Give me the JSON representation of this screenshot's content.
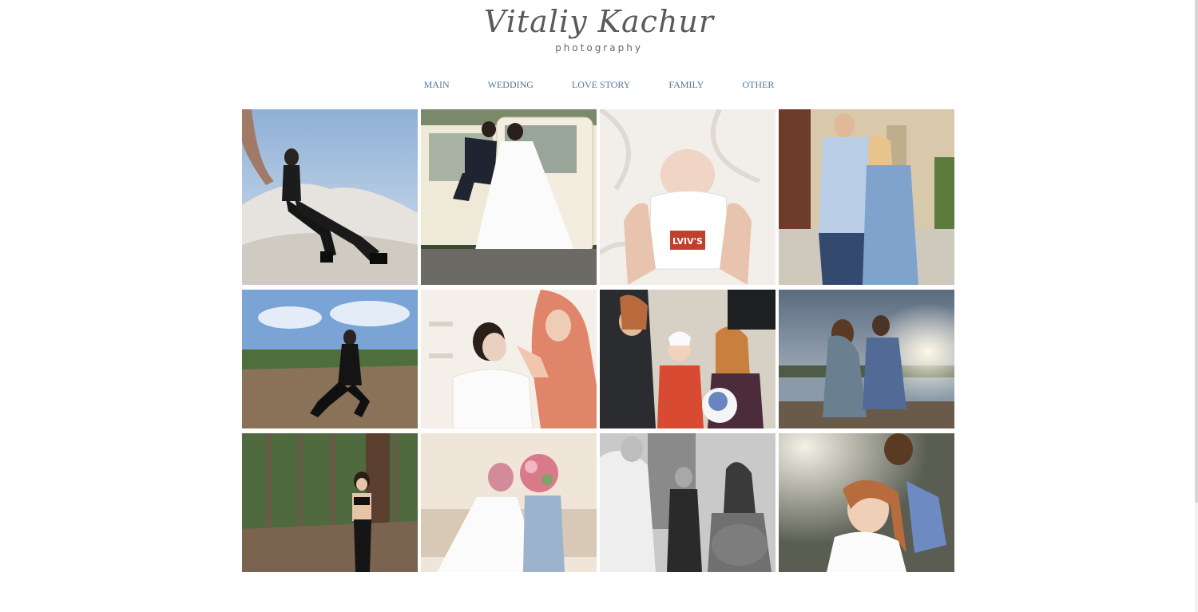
{
  "site": {
    "logo_script": "Vitaliy Kachur",
    "logo_sub": "photography"
  },
  "nav": {
    "items": [
      {
        "label": "MAIN"
      },
      {
        "label": "WEDDING"
      },
      {
        "label": "LOVE STORY"
      },
      {
        "label": "FAMILY"
      },
      {
        "label": "OTHER"
      }
    ],
    "color": "#4f78a3"
  },
  "gallery": {
    "photos": [
      {
        "subject": "Woman in black sitting on white sand dune"
      },
      {
        "subject": "Bride and groom kissing through vintage car door"
      },
      {
        "subject": "Sleeping baby in LVIV'S t-shirt on white sheets",
        "shirt_text": "LVIV'S"
      },
      {
        "subject": "Couple embracing in front of old house"
      },
      {
        "subject": "Woman in leather outfit sitting in a field near forest"
      },
      {
        "subject": "Bride getting makeup done"
      },
      {
        "subject": "Family with child in red coat outdoors"
      },
      {
        "subject": "Couple sitting by a lake at sunset"
      },
      {
        "subject": "Woman in sunglasses leaning on a tree in forest"
      },
      {
        "subject": "Bride and bridesmaid holding flowers over faces"
      },
      {
        "subject": "Black and white christening ceremony"
      },
      {
        "subject": "Smiling woman with flower crown in sunlight"
      }
    ]
  }
}
